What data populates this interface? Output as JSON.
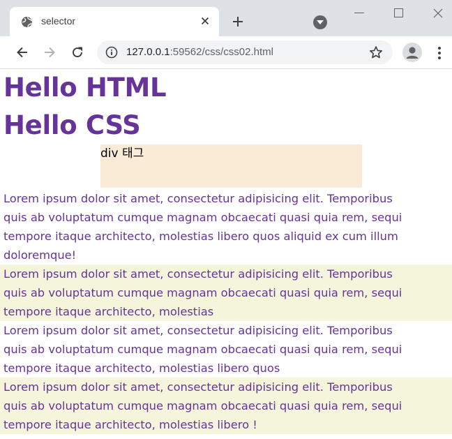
{
  "browser": {
    "tab": {
      "title": "selector"
    },
    "address": {
      "host": "127.0.0.1",
      "path": ":59562/css/css02.html"
    }
  },
  "page": {
    "headings": [
      "Hello HTML",
      "Hello CSS"
    ],
    "div_text": "div 태그",
    "paragraphs": [
      {
        "lines": [
          "Lorem ipsum dolor sit amet, consectetur adipisicing elit. Temporibus",
          "quis ab voluptatum cumque magnam obcaecati quasi quia rem, sequi",
          "tempore itaque architecto, molestias libero quos aliquid ex cum illum",
          "doloremque!"
        ]
      },
      {
        "lines": [
          "Lorem ipsum dolor sit amet, consectetur adipisicing elit. Temporibus",
          "quis ab voluptatum cumque magnam obcaecati quasi quia rem, sequi",
          "tempore itaque architecto, molestias"
        ]
      },
      {
        "lines": [
          "Lorem ipsum dolor sit amet, consectetur adipisicing elit. Temporibus",
          "quis ab voluptatum cumque magnam obcaecati quasi quia rem, sequi",
          "tempore itaque architecto, molestias libero quos"
        ]
      },
      {
        "lines": [
          "Lorem ipsum dolor sit amet, consectetur adipisicing elit. Temporibus",
          "quis ab voluptatum cumque magnam obcaecati quasi quia rem, sequi",
          "tempore itaque architecto, molestias libero !"
        ]
      }
    ]
  },
  "colors": {
    "heading_text": "#663399",
    "div_background": "#faebd7",
    "alt_paragraph_background": "#f5f5dc"
  },
  "icons": {
    "favicon": "globe-icon",
    "tab_close": "close-icon",
    "new_tab": "plus-icon",
    "tab_search": "chevron-down-icon",
    "back": "back-arrow-icon",
    "forward": "forward-arrow-icon",
    "reload": "reload-icon",
    "site_info": "info-icon",
    "bookmark": "star-icon",
    "profile": "avatar-icon",
    "menu": "kebab-menu-icon"
  }
}
